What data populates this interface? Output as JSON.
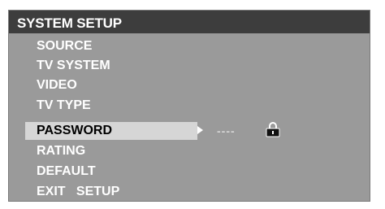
{
  "menu": {
    "title": "SYSTEM SETUP",
    "items": [
      {
        "label": "SOURCE"
      },
      {
        "label": "TV SYSTEM"
      },
      {
        "label": "VIDEO"
      },
      {
        "label": "TV TYPE"
      },
      {
        "label": "PASSWORD",
        "selected": true
      },
      {
        "label": "RATING"
      },
      {
        "label": "DEFAULT"
      },
      {
        "label": "EXIT   SETUP"
      }
    ]
  },
  "password": {
    "value_mask": "----",
    "icons": [
      "arrow-right-icon",
      "lock-icon"
    ]
  },
  "colors": {
    "panel_bg": "#9a9a9a",
    "title_bg": "#3d3d3d",
    "selected_bg": "#d6d6d6",
    "text": "#ffffff"
  }
}
